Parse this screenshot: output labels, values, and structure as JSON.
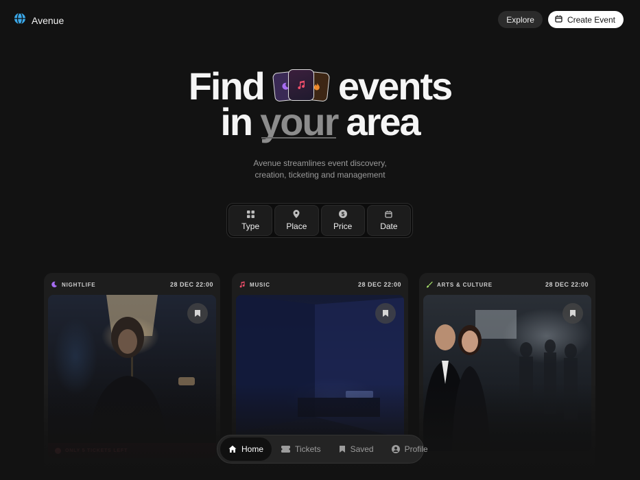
{
  "header": {
    "brand_name": "Avenue",
    "explore_label": "Explore",
    "create_event_label": "Create Event"
  },
  "hero": {
    "title_part1": "Find",
    "title_part2": "events",
    "title_part3": "in",
    "title_accent": "your",
    "title_part4": "area",
    "subtitle_line1": "Avenue streamlines event discovery,",
    "subtitle_line2": "creation, ticketing and management"
  },
  "filters": [
    {
      "label": "Type",
      "icon": "grid-icon"
    },
    {
      "label": "Place",
      "icon": "map-pin-icon"
    },
    {
      "label": "Price",
      "icon": "dollar-coin-icon"
    },
    {
      "label": "Date",
      "icon": "calendar-icon"
    }
  ],
  "events": [
    {
      "category": "NIGHTLIFE",
      "date": "28 DEC 22:00",
      "icon": "moon-icon",
      "icon_color": "#a56cf0",
      "badge": "ONLY 5 TICKETS LEFT"
    },
    {
      "category": "MUSIC",
      "date": "28 DEC 22:00",
      "icon": "music-note-icon",
      "icon_color": "#ef4e6a"
    },
    {
      "category": "ARTS & CULTURE",
      "date": "28 DEC 22:00",
      "icon": "brush-icon",
      "icon_color": "#a6e06a"
    }
  ],
  "bottom_nav": [
    {
      "label": "Home",
      "icon": "home-icon",
      "active": true
    },
    {
      "label": "Tickets",
      "icon": "ticket-icon",
      "active": false
    },
    {
      "label": "Saved",
      "icon": "bookmark-icon",
      "active": false
    },
    {
      "label": "Profile",
      "icon": "user-circle-icon",
      "active": false
    }
  ],
  "colors": {
    "background": "#121212",
    "card": "#1d1d1d",
    "accent_text": "#8c8c8c",
    "badge_text": "#b04a55"
  }
}
